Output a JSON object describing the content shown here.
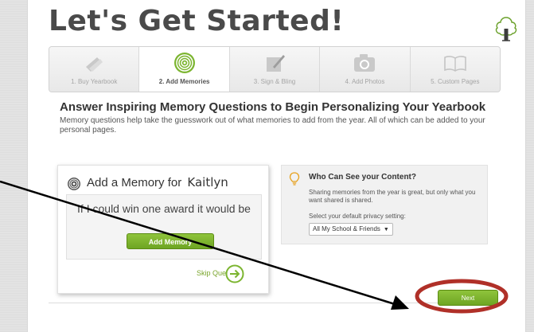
{
  "page": {
    "title": "Let's Get Started!",
    "heading": "Answer Inspiring Memory Questions to Begin Personalizing Your Yearbook",
    "subtext": "Memory questions help take the guesswork out of what memories to add from the year. All of which can be added to your personal pages."
  },
  "steps": [
    {
      "label": "1. Buy Yearbook",
      "icon": "yearbook-ticket-icon",
      "active": false
    },
    {
      "label": "2. Add Memories",
      "icon": "memory-spiral-icon",
      "active": true
    },
    {
      "label": "3. Sign & Bling",
      "icon": "sign-pen-icon",
      "active": false
    },
    {
      "label": "4. Add Photos",
      "icon": "camera-icon",
      "active": false
    },
    {
      "label": "5. Custom Pages",
      "icon": "open-book-icon",
      "active": false
    }
  ],
  "memory": {
    "title_prefix": "Add a Memory for",
    "name": "Kaitlyn",
    "question": "If I could win one award it would be",
    "add_button": "Add Memory",
    "skip_label": "Skip Question"
  },
  "privacy": {
    "title": "Who Can See your Content?",
    "text": "Sharing memories from the year is great, but only what you want shared is shared.",
    "select_label": "Select your default privacy setting:",
    "selected": "All My School & Friends"
  },
  "footer": {
    "next_button": "Next"
  },
  "colors": {
    "accent_green": "#7cb530",
    "annotation_red": "#b03028",
    "title_gray": "#4a4a4a"
  }
}
